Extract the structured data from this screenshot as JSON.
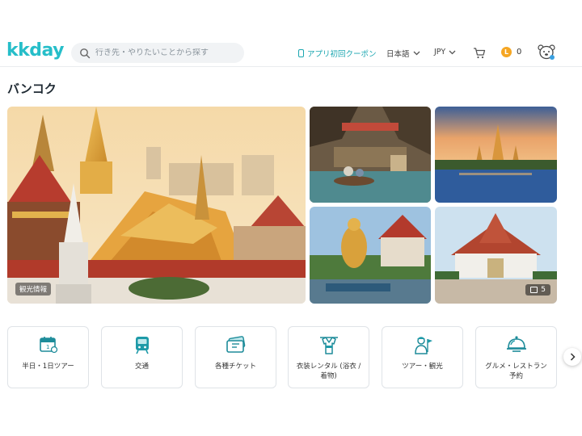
{
  "header": {
    "logo": "kkday",
    "search_placeholder": "行き先・やりたいことから探す",
    "coupon_label": "アプリ初回クーポン",
    "language": "日本語",
    "currency": "JPY",
    "points": "0"
  },
  "page": {
    "title": "バンコク"
  },
  "gallery": {
    "main_badge": "観光情報",
    "photo_count": "5"
  },
  "categories": [
    {
      "label": "半日・1日ツアー",
      "icon": "calendar-pin-icon"
    },
    {
      "label": "交通",
      "icon": "train-icon"
    },
    {
      "label": "各種チケット",
      "icon": "ticket-icon"
    },
    {
      "label": "衣装レンタル (浴衣 / 着物)",
      "icon": "kimono-icon"
    },
    {
      "label": "ツアー・観光",
      "icon": "tour-guide-icon"
    },
    {
      "label": "グルメ・レストラン予約",
      "icon": "dining-cloche-icon"
    }
  ],
  "colors": {
    "brand": "#26bec9",
    "icon_teal": "#1e9aa8",
    "text": "#26323d"
  }
}
